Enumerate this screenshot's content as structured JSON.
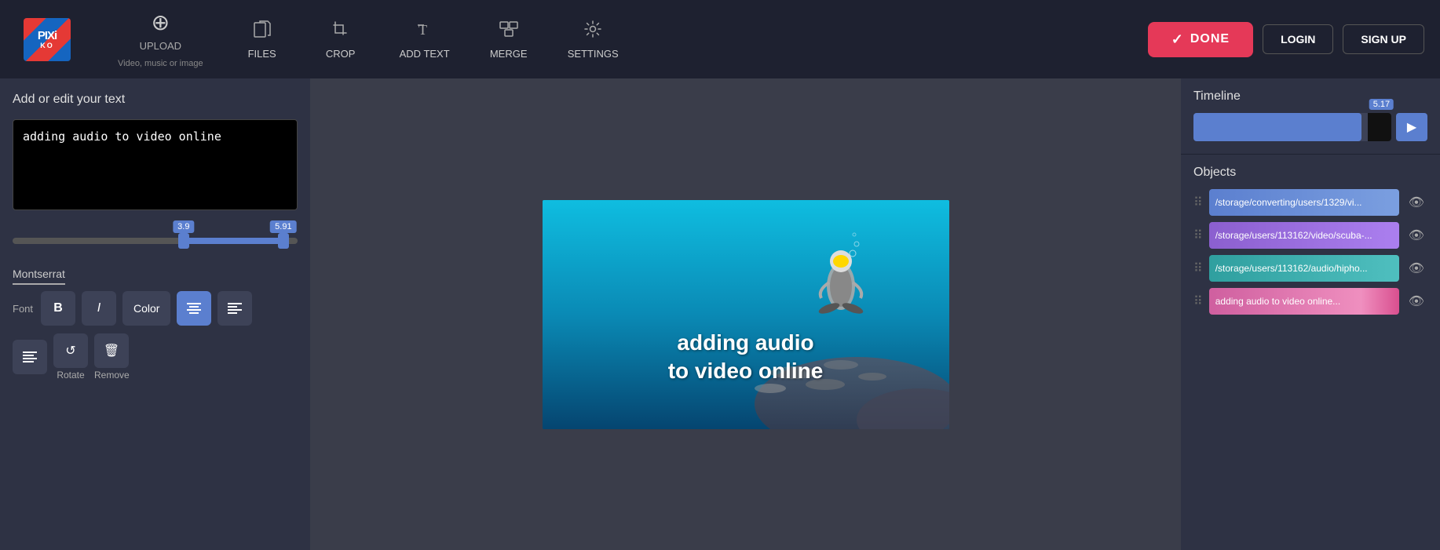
{
  "app": {
    "name": "PIXIKO",
    "tagline": "PIXIKO"
  },
  "nav": {
    "upload_label": "UPLOAD",
    "upload_sublabel": "Video, music or image",
    "files_label": "FILES",
    "crop_label": "CROP",
    "add_text_label": "ADD TEXT",
    "merge_label": "MERGE",
    "settings_label": "SETTINGS",
    "done_label": "DONE",
    "login_label": "LOGIN",
    "signup_label": "SIGN UP"
  },
  "left_panel": {
    "title": "Add or edit your text",
    "text_content": "adding audio to video online",
    "slider_left_badge": "3.9",
    "slider_right_badge": "5.91",
    "font_name": "Montserrat",
    "font_label": "Font",
    "bold_label": "B",
    "italic_label": "I",
    "color_label": "Color",
    "align_left_label": "≡",
    "align_center_label": "≡",
    "rotate_label": "Rotate",
    "remove_label": "Remove"
  },
  "video": {
    "overlay_text_line1": "adding audio",
    "overlay_text_line2": "to video online"
  },
  "right_panel": {
    "timeline_title": "Timeline",
    "timeline_badge": "5.17",
    "objects_title": "Objects",
    "objects": [
      {
        "path": "/storage/converting/users/1329/vi...",
        "color": "obj-blue"
      },
      {
        "path": "/storage/users/113162/video/scuba-...",
        "color": "obj-purple"
      },
      {
        "path": "/storage/users/113162/audio/hipho...",
        "color": "obj-teal"
      },
      {
        "path": "adding audio to video online...",
        "color": "obj-pink"
      }
    ]
  }
}
